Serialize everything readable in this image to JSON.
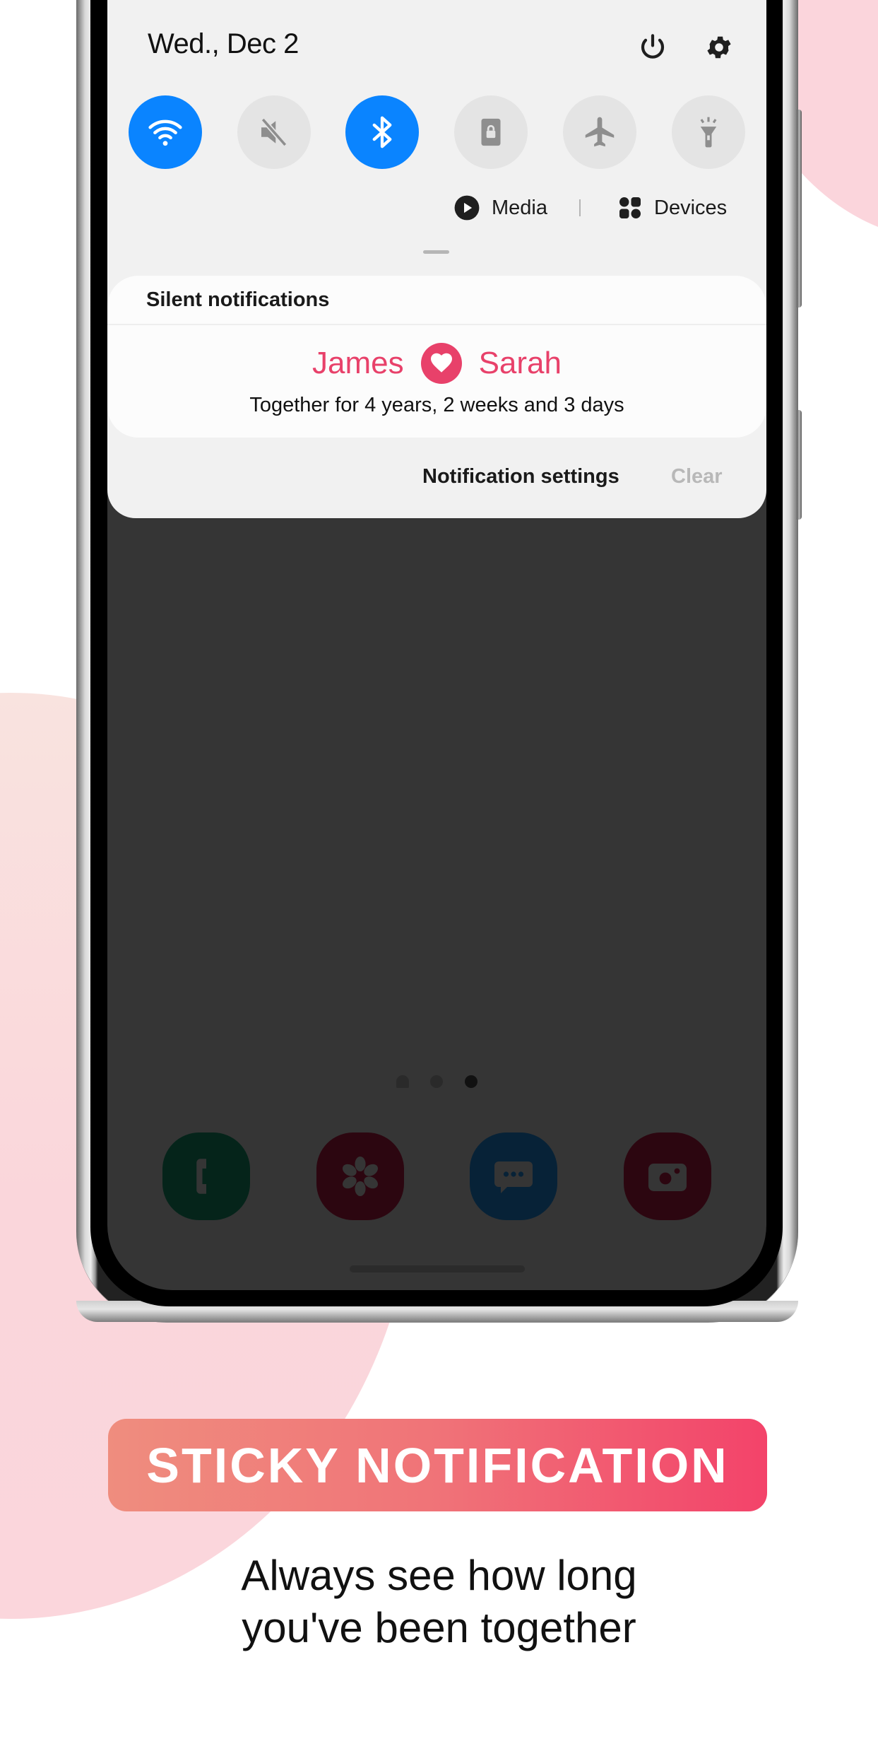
{
  "status_panel": {
    "date": "Wed., Dec 2",
    "power_icon": "power-icon",
    "settings_icon": "gear-icon"
  },
  "quick_tiles": [
    {
      "name": "Wi-Fi",
      "icon": "wifi-icon",
      "on": true
    },
    {
      "name": "Sound",
      "icon": "mute-icon",
      "on": false
    },
    {
      "name": "Bluetooth",
      "icon": "bluetooth-icon",
      "on": true
    },
    {
      "name": "Secure Folder",
      "icon": "lock-icon",
      "on": false
    },
    {
      "name": "Airplane mode",
      "icon": "airplane-icon",
      "on": false
    },
    {
      "name": "Flashlight",
      "icon": "flashlight-icon",
      "on": false
    }
  ],
  "quick_bar": {
    "media_label": "Media",
    "devices_label": "Devices"
  },
  "notification_group": {
    "title": "Silent notifications",
    "notification": {
      "name_left": "James",
      "name_right": "Sarah",
      "duration": "Together for 4 years, 2 weeks and 3 days"
    },
    "settings_label": "Notification settings",
    "clear_label": "Clear"
  },
  "home_screen": {
    "pages": 3,
    "active_page": 3,
    "dock": [
      {
        "app": "Phone",
        "icon": "phone-icon"
      },
      {
        "app": "Gallery",
        "icon": "flower-icon"
      },
      {
        "app": "Messages",
        "icon": "message-icon"
      },
      {
        "app": "Camera",
        "icon": "camera-icon"
      }
    ]
  },
  "colors": {
    "accent_pink": "#e8416a",
    "tile_on_blue": "#0a84ff",
    "banner_gradient_start": "#ef8d7e",
    "banner_gradient_end": "#f3436a"
  },
  "promo": {
    "banner": "STICKY NOTIFICATION",
    "tagline_line1": "Always see how long",
    "tagline_line2": "you've been together"
  }
}
